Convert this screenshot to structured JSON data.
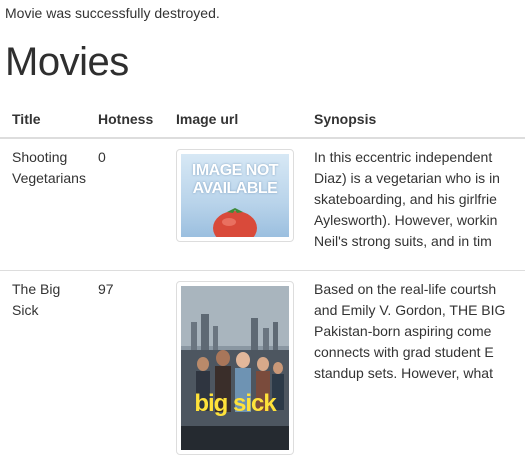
{
  "notice": "Movie was successfully destroyed.",
  "page_title": "Movies",
  "table": {
    "headers": [
      "Title",
      "Hotness",
      "Image url",
      "Synopsis"
    ],
    "rows": [
      {
        "title_line1": "Shooting",
        "title_line2": "Vegetarians",
        "hotness": "0",
        "image_text_line1": "IMAGE NOT",
        "image_text_line2": "AVAILABLE",
        "synopsis_lines": [
          "In this eccentric independent",
          "Diaz) is a vegetarian who is in",
          "skateboarding, and his girlfrie",
          "Aylesworth). However, workin",
          "Neil's strong suits, and in tim"
        ]
      },
      {
        "title_line1": "The Big",
        "title_line2": "Sick",
        "hotness": "97",
        "poster_title": "big sick",
        "synopsis_lines": [
          "Based on the real-life courtsh",
          "and Emily V. Gordon, THE BIG",
          "Pakistan-born aspiring come",
          "connects with grad student E",
          "standup sets. However, what"
        ]
      }
    ]
  }
}
